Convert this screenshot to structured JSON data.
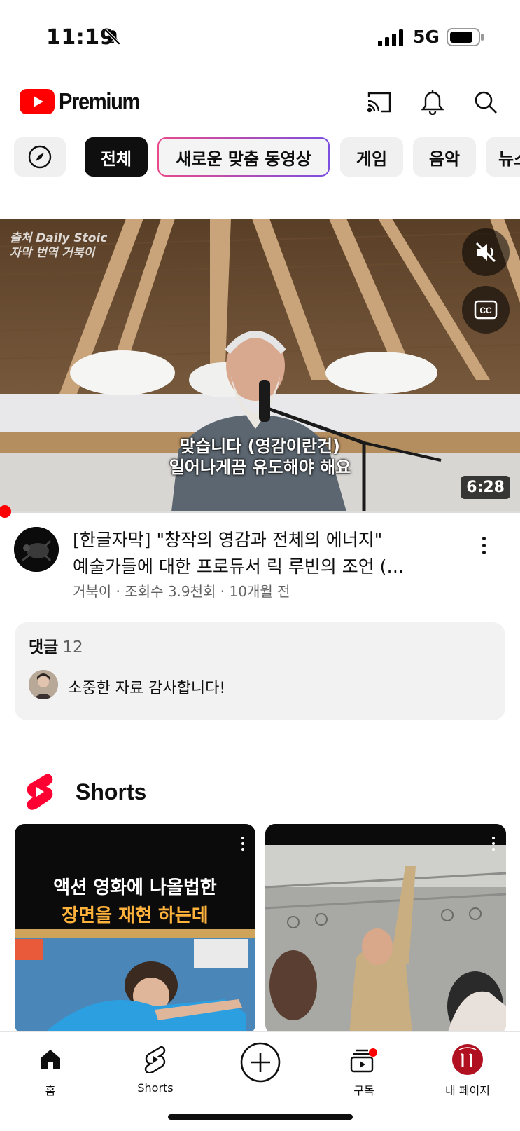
{
  "status_bar": {
    "time": "11:19",
    "network": "5G"
  },
  "header": {
    "brand": "Premium",
    "brand_color": "#ff0000",
    "icons": [
      "cast-icon",
      "notification-bell-icon",
      "search-icon"
    ]
  },
  "chips": [
    {
      "label": "",
      "icon": "explore-compass-icon"
    },
    {
      "label": "전체",
      "selected": true
    },
    {
      "label": "새로운 맞춤 동영상"
    },
    {
      "label": "게임"
    },
    {
      "label": "음악"
    },
    {
      "label": "뉴스"
    }
  ],
  "video": {
    "watermark_line1": "출처 Daily Stoic",
    "watermark_line2": "자막 번역 거북이",
    "subtitle_line1": "맞습니다 (영감이란건)",
    "subtitle_line2": "일어나게끔 유도해야 해요",
    "duration": "6:28",
    "cc_label": "CC",
    "progress": 0.0,
    "title_line1": "[한글자막] \"창작의 영감과 전체의 에너지\"",
    "title_line2": "예술가들에 대한 프로듀서 릭 루빈의 조언 (…",
    "meta": "거북이 · 조회수 3.9천회 · 10개월 전"
  },
  "comments": {
    "label": "댓글",
    "count": "12",
    "top_comment": "소중한 자료 감사합니다!"
  },
  "shorts": {
    "section_label": "Shorts",
    "items": [
      {
        "caption_line1": "액션 영화에 나올법한",
        "caption_line2": "장면을 재현 하는데"
      },
      {
        "caption_line1": ""
      }
    ]
  },
  "bottom_nav": [
    {
      "label": "홈",
      "icon": "home-icon",
      "active": true
    },
    {
      "label": "Shorts",
      "icon": "shorts-icon"
    },
    {
      "label": "",
      "icon": "create-plus-icon"
    },
    {
      "label": "구독",
      "icon": "subscriptions-icon",
      "badge": true
    },
    {
      "label": "내 페이지",
      "icon": "profile-avatar-icon"
    }
  ]
}
